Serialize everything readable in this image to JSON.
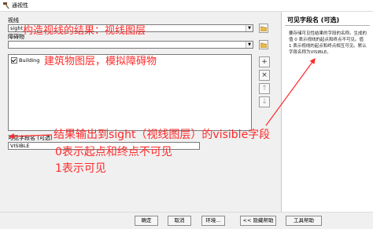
{
  "window": {
    "title": "通视性"
  },
  "sight_lines": {
    "label": "视线",
    "value": "sight"
  },
  "obstructions": {
    "label": "障碍物",
    "value": "",
    "items": [
      "Building"
    ]
  },
  "visible_field": {
    "label": "可见字段名 (可选)",
    "value": "VISIBLE"
  },
  "help": {
    "title": "可见字段名 (可选)",
    "body": "要存储可见性结果的字段的名称。生成的值 0 表示视线的起点和终点不可见。值 1 表示视线的起点和终点相互可见。默认字段名称为VISIBLE。"
  },
  "buttons": {
    "ok": "确定",
    "cancel": "取消",
    "env": "环境...",
    "hide_help": "<< 隐藏帮助",
    "tool_help": "工具帮助"
  },
  "annotations": {
    "a1": "构造视线的结果：视线图层",
    "a2": "建筑物图层，模拟障碍物",
    "a3": "结果输出到sight（视线图层）的visible字段",
    "a4": "0表示起点和终点不可见",
    "a5": "1表示可见"
  },
  "colors": {
    "annotation": "#ff2a2a"
  }
}
